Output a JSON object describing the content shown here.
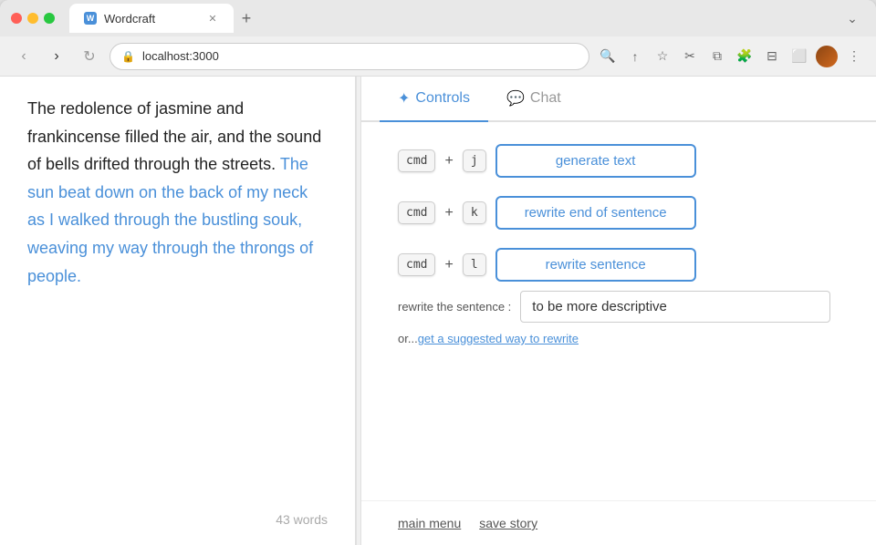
{
  "browser": {
    "tab_title": "Wordcraft",
    "address": "localhost:3000",
    "chevron_label": "›"
  },
  "editor": {
    "text_normal_1": "The redolence of jasmine and frankincense filled the air, and the sound of bells drifted through the streets. ",
    "text_highlighted": "The sun beat down on the back of my neck as I walked through the bustling souk, weaving my way through the throngs of people.",
    "word_count": "43 words"
  },
  "controls_panel": {
    "tabs": [
      {
        "label": "Controls",
        "active": true,
        "icon": "✦"
      },
      {
        "label": "Chat",
        "active": false,
        "icon": "💬"
      }
    ],
    "shortcuts": [
      {
        "modifier": "cmd",
        "key": "j",
        "action": "generate text"
      },
      {
        "modifier": "cmd",
        "key": "k",
        "action": "rewrite end of sentence"
      },
      {
        "modifier": "cmd",
        "key": "l",
        "action": "rewrite sentence"
      }
    ],
    "rewrite_label": "rewrite the sentence :",
    "rewrite_input_value": "to be more descriptive",
    "or_prefix": "or...",
    "suggested_link": "get a suggested way to rewrite"
  },
  "bottom_actions": {
    "main_menu_label": "main menu",
    "save_story_label": "save story"
  }
}
